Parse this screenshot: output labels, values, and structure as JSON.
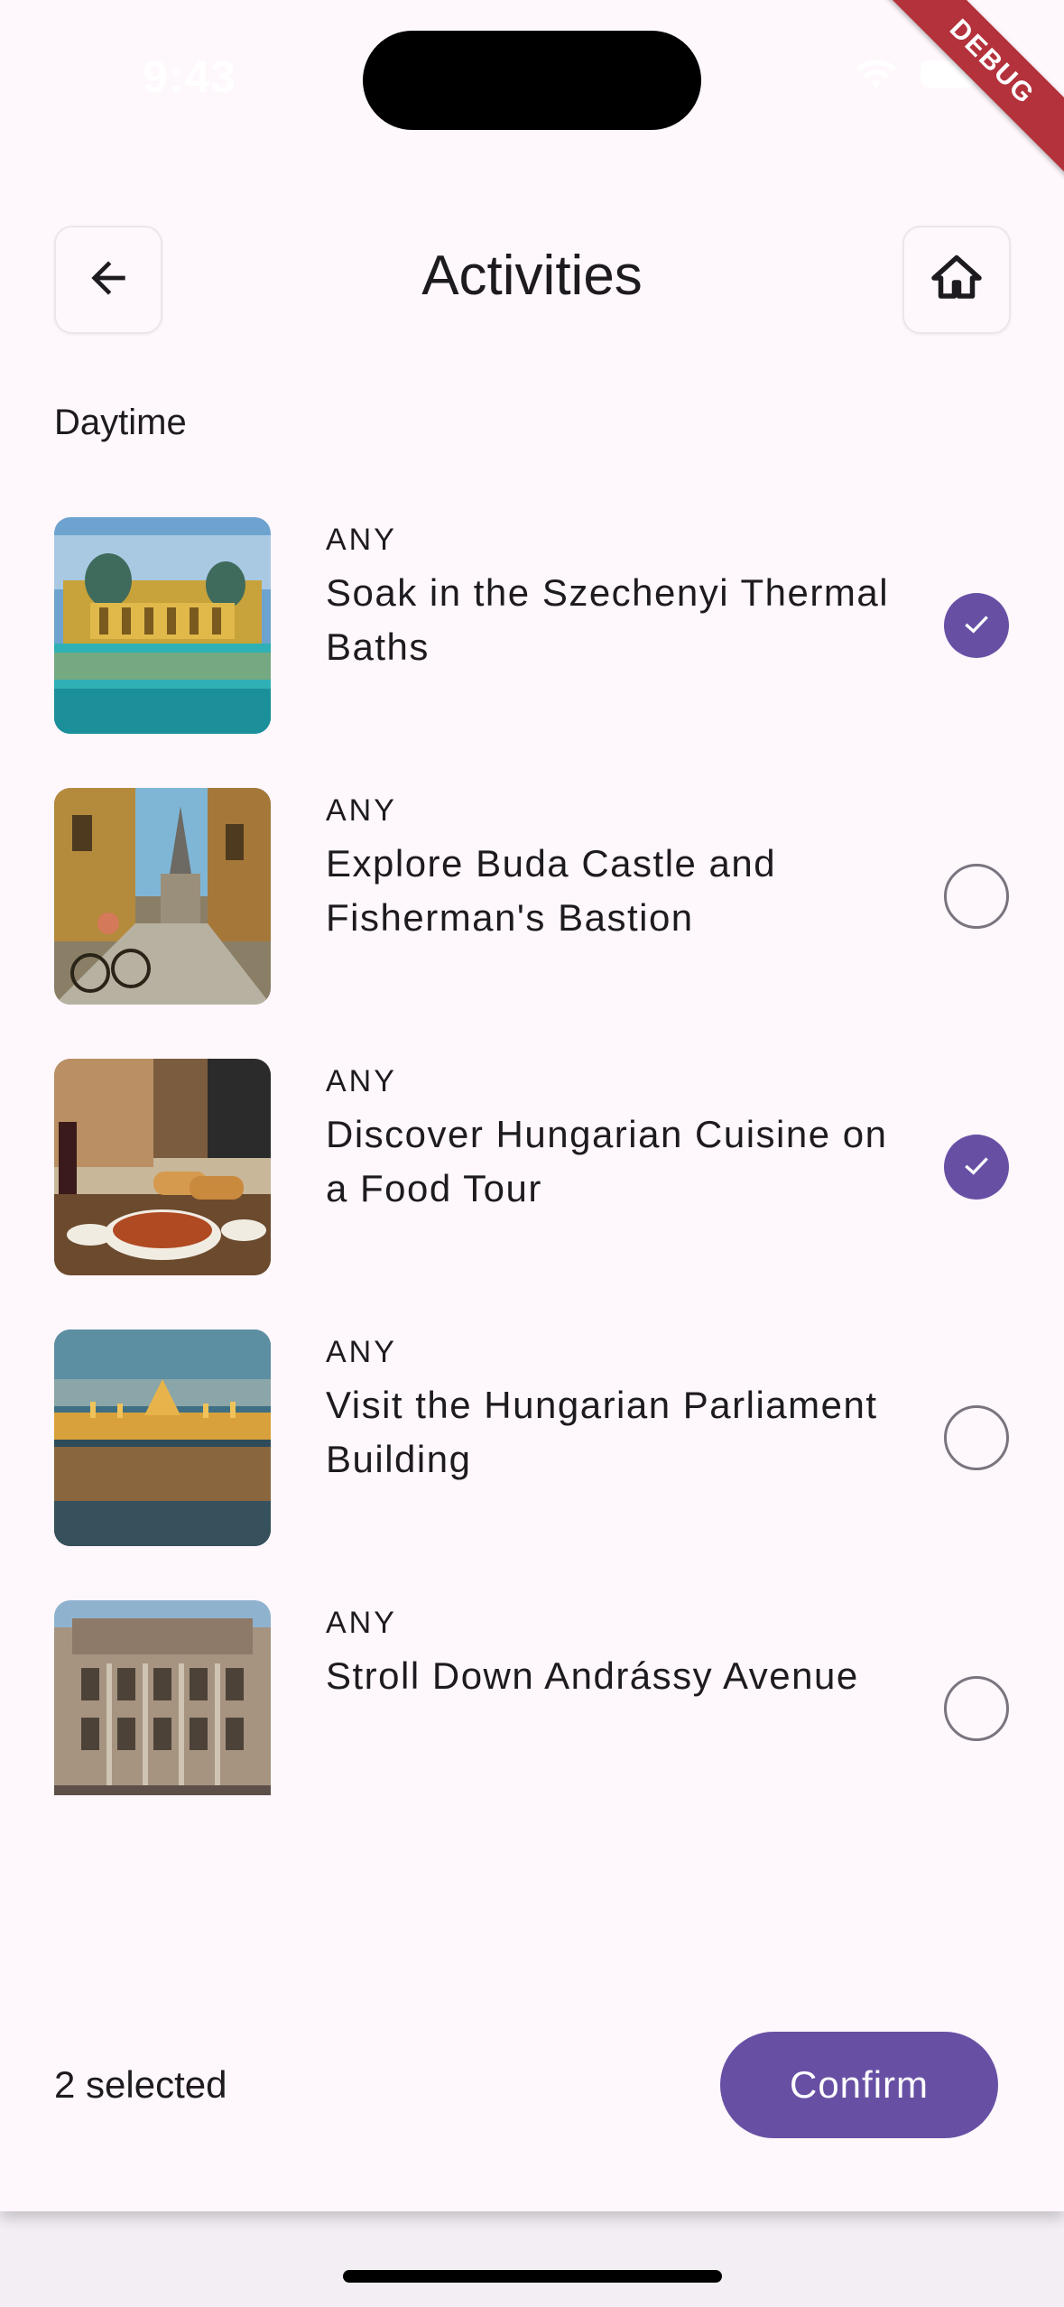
{
  "status_bar": {
    "time": "9:43"
  },
  "debug_banner": "DEBUG",
  "header": {
    "title": "Activities",
    "back_icon": "arrow-left-icon",
    "home_icon": "home-icon"
  },
  "section": {
    "label": "Daytime"
  },
  "activities": [
    {
      "tag": "ANY",
      "title": "Soak in the Szechenyi Thermal Baths",
      "selected": true,
      "image": "thermal-baths-photo"
    },
    {
      "tag": "ANY",
      "title": "Explore Buda Castle and Fisherman's Bastion",
      "selected": false,
      "image": "castle-street-photo"
    },
    {
      "tag": "ANY",
      "title": "Discover Hungarian Cuisine on a Food Tour",
      "selected": true,
      "image": "food-table-photo"
    },
    {
      "tag": "ANY",
      "title": "Visit the Hungarian Parliament Building",
      "selected": false,
      "image": "parliament-photo"
    },
    {
      "tag": "ANY",
      "title": "Stroll Down Andrássy Avenue",
      "selected": false,
      "image": "avenue-building-photo"
    }
  ],
  "footer": {
    "selected_text": "2 selected",
    "confirm_label": "Confirm"
  },
  "colors": {
    "accent": "#6750a4",
    "background": "#fef7fc",
    "text": "#1d1b20"
  }
}
